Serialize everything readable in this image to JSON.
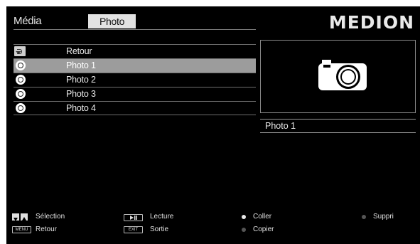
{
  "header": {
    "section_title": "Média",
    "active_tab": "Photo",
    "brand": "MEDION"
  },
  "list": {
    "items": [
      {
        "label": "Retour",
        "icon": "back-icon",
        "selected": false
      },
      {
        "label": "Photo 1",
        "icon": "photo-file-icon",
        "selected": true
      },
      {
        "label": "Photo 2",
        "icon": "photo-file-icon",
        "selected": false
      },
      {
        "label": "Photo 3",
        "icon": "photo-file-icon",
        "selected": false
      },
      {
        "label": "Photo 4",
        "icon": "photo-file-icon",
        "selected": false
      }
    ]
  },
  "preview": {
    "title": "Photo 1",
    "icon": "camera-icon"
  },
  "footer": {
    "selection": "Sélection",
    "play": "Lecture",
    "paste": "Coller",
    "delete": "Suppri",
    "back": "Retour",
    "exit": "Sortie",
    "copy": "Copier",
    "menu_key": "MENU",
    "exit_key": "EXIT",
    "colors": {
      "paste_dot": "#e8e8e8",
      "copy_dot": "#555555",
      "delete_dot": "#555555"
    }
  }
}
